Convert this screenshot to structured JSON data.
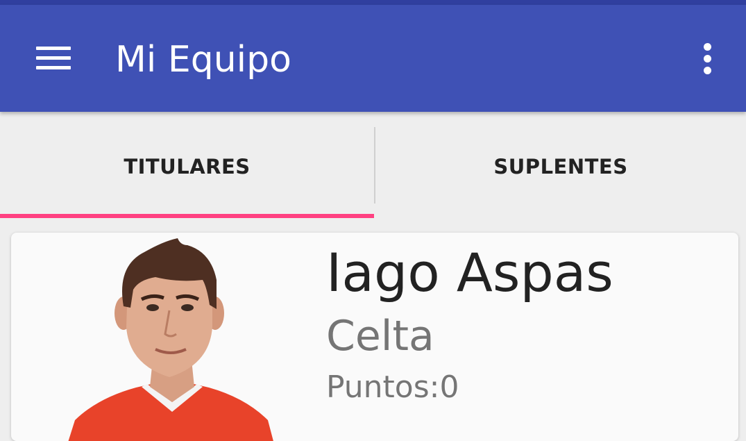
{
  "app_bar": {
    "title": "Mi Equipo",
    "menu_icon": "hamburger-menu-icon",
    "overflow_icon": "more-vert-icon",
    "color": "#3f51b5",
    "status_color": "#303f9f"
  },
  "tabs": [
    {
      "label": "TITULARES",
      "selected": true
    },
    {
      "label": "SUPLENTES",
      "selected": false
    }
  ],
  "tab_indicator_color": "#ff4081",
  "players": [
    {
      "name": "Iago Aspas",
      "team": "Celta",
      "points_text": "Puntos:0"
    }
  ]
}
